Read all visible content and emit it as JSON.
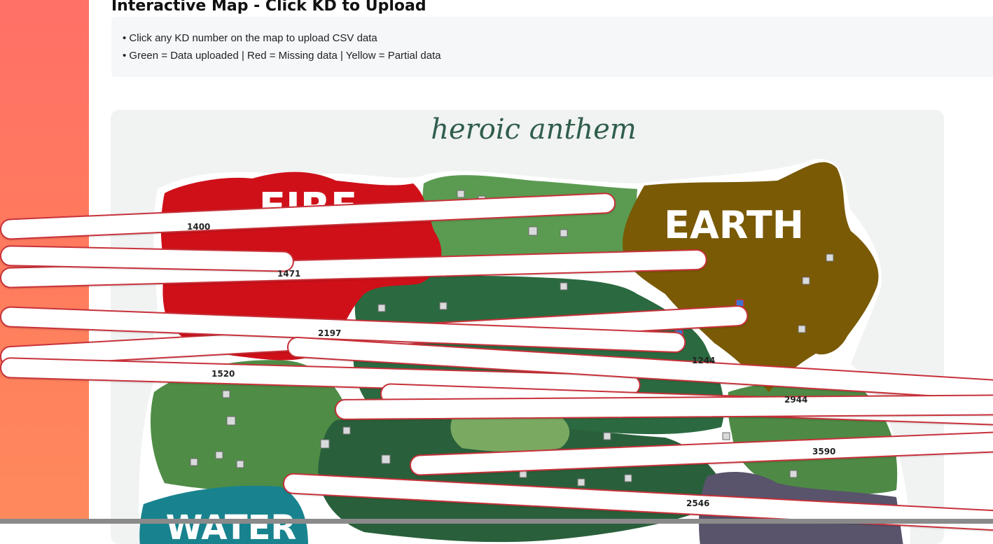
{
  "page": {
    "title": "Interactive Map - Click KD to Upload",
    "instructions": [
      "• Click any KD number on the map to upload CSV data",
      "• Green = Data uploaded | Red = Missing data | Yellow = Partial data"
    ]
  },
  "map": {
    "heading": "heroic anthem",
    "regions": [
      {
        "name": "FIRE",
        "color": "#d0131c"
      },
      {
        "name": "EARTH",
        "color": "#7a5a05"
      },
      {
        "name": "WATER",
        "color": "#1b8a96"
      }
    ],
    "status_colors": {
      "missing": "#c8323a",
      "uploaded": "#2e9a4a",
      "partial": "#e8c12e"
    },
    "kd_numbers": [
      {
        "id": "1400",
        "status": "missing"
      },
      {
        "id": "1471",
        "status": "missing"
      },
      {
        "id": "2197",
        "status": "missing"
      },
      {
        "id": "1520",
        "status": "missing"
      },
      {
        "id": "1244",
        "status": "missing"
      },
      {
        "id": "2944",
        "status": "missing"
      },
      {
        "id": "3590",
        "status": "missing"
      },
      {
        "id": "2546",
        "status": "missing"
      }
    ]
  }
}
